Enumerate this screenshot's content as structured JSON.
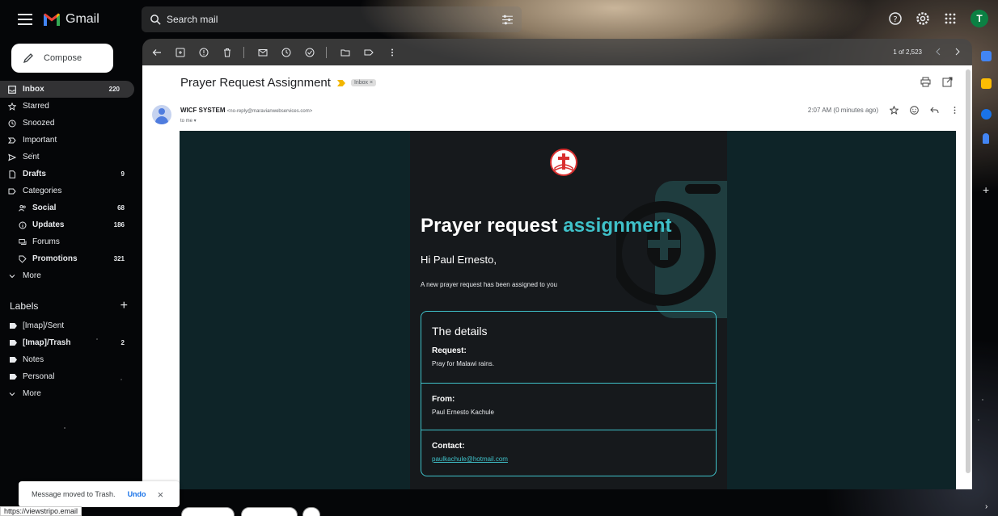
{
  "app": {
    "name": "Gmail",
    "avatar_letter": "T"
  },
  "search": {
    "placeholder": "Search mail"
  },
  "compose": {
    "label": "Compose"
  },
  "nav": [
    {
      "label": "Inbox",
      "count": "220",
      "icon": "inbox-icon"
    },
    {
      "label": "Starred",
      "count": "",
      "icon": "star-icon"
    },
    {
      "label": "Snoozed",
      "count": "",
      "icon": "clock-icon"
    },
    {
      "label": "Important",
      "count": "",
      "icon": "important-icon"
    },
    {
      "label": "Sent",
      "count": "",
      "icon": "send-icon"
    },
    {
      "label": "Drafts",
      "count": "9",
      "icon": "draft-icon"
    },
    {
      "label": "Categories",
      "count": "",
      "icon": "label-icon"
    },
    {
      "label": "Social",
      "count": "68",
      "icon": "people-icon"
    },
    {
      "label": "Updates",
      "count": "186",
      "icon": "info-icon"
    },
    {
      "label": "Forums",
      "count": "",
      "icon": "forum-icon"
    },
    {
      "label": "Promotions",
      "count": "321",
      "icon": "tag-icon"
    },
    {
      "label": "More",
      "count": "",
      "icon": "chevron-down-icon"
    }
  ],
  "labels": {
    "title": "Labels",
    "items": [
      {
        "label": "[Imap]/Sent",
        "count": ""
      },
      {
        "label": "[Imap]/Trash",
        "count": "2"
      },
      {
        "label": "Notes",
        "count": ""
      },
      {
        "label": "Personal",
        "count": ""
      },
      {
        "label": "More",
        "count": ""
      }
    ]
  },
  "toolbar": {
    "pager": "1 of 2,523"
  },
  "email": {
    "subject": "Prayer Request Assignment",
    "chip": "Inbox ×",
    "sender_name": "WICF SYSTEM",
    "sender_addr": "<no-reply@maravianwebservices.com>",
    "to": "to me ▾",
    "time": "2:07 AM (0 minutes ago)",
    "heading_a": "Prayer request",
    "heading_b": "assignment",
    "greeting": "Hi Paul Ernesto,",
    "intro": "A new prayer request has been assigned to you",
    "details_title": "The details",
    "request_label": "Request:",
    "request_value": "Pray for Malawi rains.",
    "from_label": "From:",
    "from_value": "Paul Ernesto Kachule",
    "contact_label": "Contact:",
    "contact_value": "paulkachule@hotmail.com"
  },
  "toast": {
    "message": "Message moved to Trash.",
    "action": "Undo",
    "close": "×"
  },
  "statusbar": {
    "url": "https://viewstripo.email"
  },
  "colors": {
    "accent": "#3fc1c9",
    "card_bg": "#16191c",
    "email_bg": "#0e2428",
    "logo_red": "#d93030"
  }
}
